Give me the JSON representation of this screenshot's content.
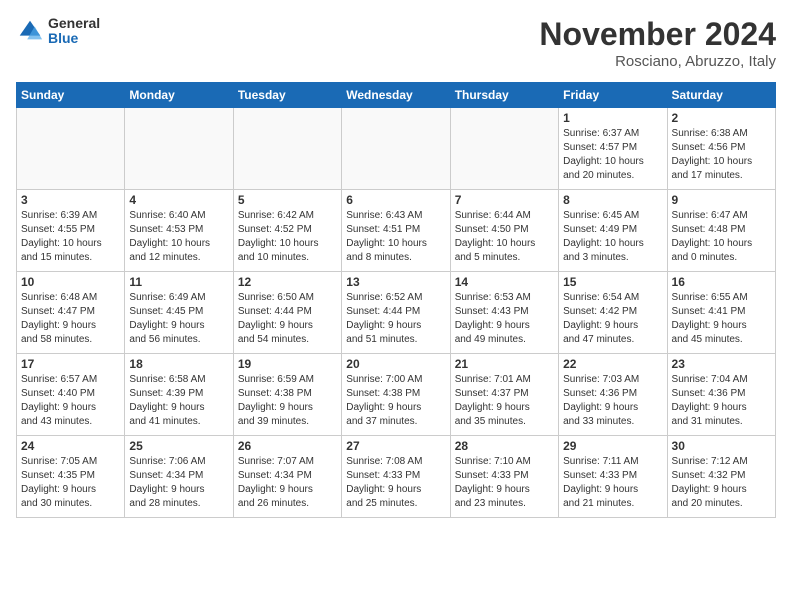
{
  "header": {
    "logo_general": "General",
    "logo_blue": "Blue",
    "month_title": "November 2024",
    "location": "Rosciano, Abruzzo, Italy"
  },
  "days_of_week": [
    "Sunday",
    "Monday",
    "Tuesday",
    "Wednesday",
    "Thursday",
    "Friday",
    "Saturday"
  ],
  "weeks": [
    [
      {
        "day": "",
        "info": ""
      },
      {
        "day": "",
        "info": ""
      },
      {
        "day": "",
        "info": ""
      },
      {
        "day": "",
        "info": ""
      },
      {
        "day": "",
        "info": ""
      },
      {
        "day": "1",
        "info": "Sunrise: 6:37 AM\nSunset: 4:57 PM\nDaylight: 10 hours\nand 20 minutes."
      },
      {
        "day": "2",
        "info": "Sunrise: 6:38 AM\nSunset: 4:56 PM\nDaylight: 10 hours\nand 17 minutes."
      }
    ],
    [
      {
        "day": "3",
        "info": "Sunrise: 6:39 AM\nSunset: 4:55 PM\nDaylight: 10 hours\nand 15 minutes."
      },
      {
        "day": "4",
        "info": "Sunrise: 6:40 AM\nSunset: 4:53 PM\nDaylight: 10 hours\nand 12 minutes."
      },
      {
        "day": "5",
        "info": "Sunrise: 6:42 AM\nSunset: 4:52 PM\nDaylight: 10 hours\nand 10 minutes."
      },
      {
        "day": "6",
        "info": "Sunrise: 6:43 AM\nSunset: 4:51 PM\nDaylight: 10 hours\nand 8 minutes."
      },
      {
        "day": "7",
        "info": "Sunrise: 6:44 AM\nSunset: 4:50 PM\nDaylight: 10 hours\nand 5 minutes."
      },
      {
        "day": "8",
        "info": "Sunrise: 6:45 AM\nSunset: 4:49 PM\nDaylight: 10 hours\nand 3 minutes."
      },
      {
        "day": "9",
        "info": "Sunrise: 6:47 AM\nSunset: 4:48 PM\nDaylight: 10 hours\nand 0 minutes."
      }
    ],
    [
      {
        "day": "10",
        "info": "Sunrise: 6:48 AM\nSunset: 4:47 PM\nDaylight: 9 hours\nand 58 minutes."
      },
      {
        "day": "11",
        "info": "Sunrise: 6:49 AM\nSunset: 4:45 PM\nDaylight: 9 hours\nand 56 minutes."
      },
      {
        "day": "12",
        "info": "Sunrise: 6:50 AM\nSunset: 4:44 PM\nDaylight: 9 hours\nand 54 minutes."
      },
      {
        "day": "13",
        "info": "Sunrise: 6:52 AM\nSunset: 4:44 PM\nDaylight: 9 hours\nand 51 minutes."
      },
      {
        "day": "14",
        "info": "Sunrise: 6:53 AM\nSunset: 4:43 PM\nDaylight: 9 hours\nand 49 minutes."
      },
      {
        "day": "15",
        "info": "Sunrise: 6:54 AM\nSunset: 4:42 PM\nDaylight: 9 hours\nand 47 minutes."
      },
      {
        "day": "16",
        "info": "Sunrise: 6:55 AM\nSunset: 4:41 PM\nDaylight: 9 hours\nand 45 minutes."
      }
    ],
    [
      {
        "day": "17",
        "info": "Sunrise: 6:57 AM\nSunset: 4:40 PM\nDaylight: 9 hours\nand 43 minutes."
      },
      {
        "day": "18",
        "info": "Sunrise: 6:58 AM\nSunset: 4:39 PM\nDaylight: 9 hours\nand 41 minutes."
      },
      {
        "day": "19",
        "info": "Sunrise: 6:59 AM\nSunset: 4:38 PM\nDaylight: 9 hours\nand 39 minutes."
      },
      {
        "day": "20",
        "info": "Sunrise: 7:00 AM\nSunset: 4:38 PM\nDaylight: 9 hours\nand 37 minutes."
      },
      {
        "day": "21",
        "info": "Sunrise: 7:01 AM\nSunset: 4:37 PM\nDaylight: 9 hours\nand 35 minutes."
      },
      {
        "day": "22",
        "info": "Sunrise: 7:03 AM\nSunset: 4:36 PM\nDaylight: 9 hours\nand 33 minutes."
      },
      {
        "day": "23",
        "info": "Sunrise: 7:04 AM\nSunset: 4:36 PM\nDaylight: 9 hours\nand 31 minutes."
      }
    ],
    [
      {
        "day": "24",
        "info": "Sunrise: 7:05 AM\nSunset: 4:35 PM\nDaylight: 9 hours\nand 30 minutes."
      },
      {
        "day": "25",
        "info": "Sunrise: 7:06 AM\nSunset: 4:34 PM\nDaylight: 9 hours\nand 28 minutes."
      },
      {
        "day": "26",
        "info": "Sunrise: 7:07 AM\nSunset: 4:34 PM\nDaylight: 9 hours\nand 26 minutes."
      },
      {
        "day": "27",
        "info": "Sunrise: 7:08 AM\nSunset: 4:33 PM\nDaylight: 9 hours\nand 25 minutes."
      },
      {
        "day": "28",
        "info": "Sunrise: 7:10 AM\nSunset: 4:33 PM\nDaylight: 9 hours\nand 23 minutes."
      },
      {
        "day": "29",
        "info": "Sunrise: 7:11 AM\nSunset: 4:33 PM\nDaylight: 9 hours\nand 21 minutes."
      },
      {
        "day": "30",
        "info": "Sunrise: 7:12 AM\nSunset: 4:32 PM\nDaylight: 9 hours\nand 20 minutes."
      }
    ]
  ]
}
